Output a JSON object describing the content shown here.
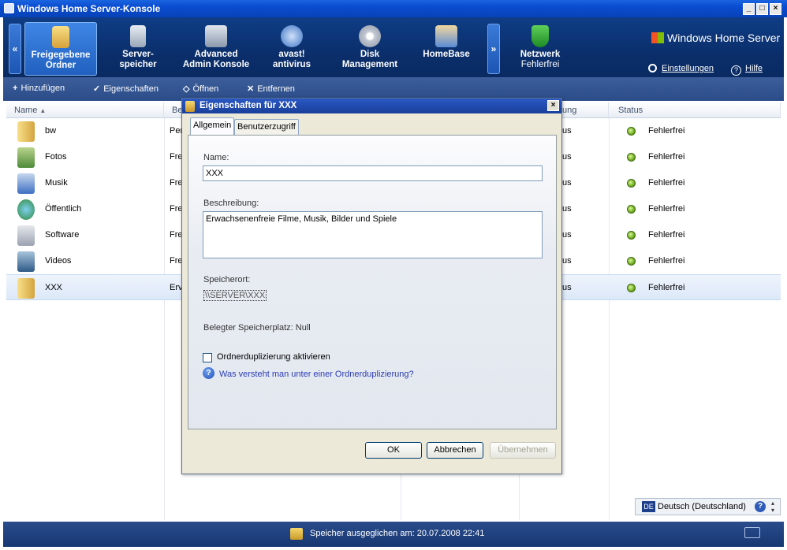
{
  "window": {
    "title": "Windows Home Server-Konsole"
  },
  "nav": {
    "tabs": [
      {
        "line1": "Freigegebene",
        "line2": "Ordner",
        "selected": true
      },
      {
        "line1": "Server-",
        "line2": "speicher"
      },
      {
        "line1": "Advanced",
        "line2": "Admin Konsole"
      },
      {
        "line1": "avast!",
        "line2": "antivirus"
      },
      {
        "line1": "Disk",
        "line2": "Management"
      },
      {
        "line1": "HomeBase",
        "line2": ""
      },
      {
        "line1": "Netzwerk",
        "line2": "Fehlerfrei"
      }
    ],
    "brand": "Windows Home Server",
    "settings": "Einstellungen",
    "help": "Hilfe",
    "left_arrow": "«",
    "right_arrow": "»"
  },
  "toolbar": {
    "add": "Hinzufügen",
    "properties": "Eigenschaften",
    "open": "Öffnen",
    "remove": "Entfernen"
  },
  "list": {
    "col_name": "Name",
    "col_desc": "Be",
    "col_dup": "ung",
    "col_status": "Status",
    "rows": [
      {
        "name": "bw",
        "desc": "Per",
        "dup": "us",
        "status": "Fehlerfrei"
      },
      {
        "name": "Fotos",
        "desc": "Fre",
        "dup": "us",
        "status": "Fehlerfrei"
      },
      {
        "name": "Musik",
        "desc": "Fre",
        "dup": "us",
        "status": "Fehlerfrei"
      },
      {
        "name": "Öffentlich",
        "desc": "Fre",
        "dup": "us",
        "status": "Fehlerfrei"
      },
      {
        "name": "Software",
        "desc": "Fre",
        "dup": "us",
        "status": "Fehlerfrei"
      },
      {
        "name": "Videos",
        "desc": "Fre",
        "dup": "us",
        "status": "Fehlerfrei"
      },
      {
        "name": "XXX",
        "desc": "Erv",
        "dup": "us",
        "status": "Fehlerfrei",
        "selected": true
      }
    ]
  },
  "dialog": {
    "title": "Eigenschaften für XXX",
    "tab_general": "Allgemein",
    "tab_access": "Benutzerzugriff",
    "name_label": "Name:",
    "name_value": "XXX",
    "desc_label": "Beschreibung:",
    "desc_value": "Erwachsenenfreie Filme, Musik, Bilder und Spiele",
    "location_label": "Speicherort:",
    "location_value": "\\\\SERVER\\XXX",
    "used_space": "Belegter Speicherplatz: Null",
    "dup_checkbox": "Ordnerduplizierung aktivieren",
    "dup_checked": false,
    "dup_help": "Was versteht man unter einer Ordnerduplizierung?",
    "ok": "OK",
    "cancel": "Abbrechen",
    "apply": "Übernehmen"
  },
  "language": {
    "code": "DE",
    "label": "Deutsch (Deutschland)"
  },
  "status": {
    "text": "Speicher ausgeglichen am: 20.07.2008 22:41"
  },
  "colors": {
    "nav_bg": "#0b2f6c",
    "title_bg": "#0a4cd0",
    "status_ok": "#6fae1c",
    "link": "#2a3cb4"
  }
}
